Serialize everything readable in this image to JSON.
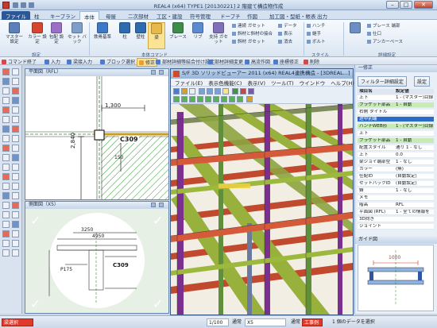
{
  "titlebar": {
    "title": "REAL4 (x64) TYPE1 [20130221] 2 階建て構造物作成"
  },
  "tabs": [
    "ファイル",
    "柱",
    "キープラン",
    "本体",
    "母屋",
    "二次部材",
    "工区・建設",
    "符号管理",
    "ドープチ",
    "作図",
    "加工図・型紙・帳表",
    "出力"
  ],
  "ribbon": {
    "big_buttons": [
      {
        "label": "マスター\n設定",
        "color": "#5b7fb8"
      },
      {
        "label": "カラー\n設定",
        "color": "#d6462e"
      },
      {
        "label": "包配\n設定",
        "color": "#9a70c6"
      },
      {
        "label": "セット\nバック",
        "color": "#7f9ec9"
      },
      {
        "label": "鉄骨基準",
        "color": "#3c78c8"
      },
      {
        "label": "柱",
        "color": "#2d6ab0"
      },
      {
        "label": "壁柱",
        "color": "#2d6ab0"
      },
      {
        "label": "梁",
        "color": "#e8b84a"
      },
      {
        "label": "ブレース",
        "color": "#3e8c4a"
      },
      {
        "label": "リブ",
        "color": "#5a8bd0"
      },
      {
        "label": "支持\nガセット",
        "color": "#8070b9"
      }
    ],
    "small_buttons": [
      "連続 ガセット",
      "斜材と斜材の接合",
      "斜材 ガセット",
      "データ",
      "表示",
      "消去",
      "ハンチ",
      "継手",
      "ボルト",
      "ブレース 端部",
      "仕口",
      "アンカーベース"
    ],
    "groups": [
      "設定",
      "本体コマンド",
      "スタイル",
      "詳細設定"
    ]
  },
  "command_bar": {
    "items": [
      "コマンド終了",
      "入力",
      "梁接入力",
      "ブロック選択",
      "修正",
      "部材詳細等結合付け設定",
      "部材詳細変更",
      "高流作図",
      "座標修正",
      "削除"
    ],
    "active_index": 4
  },
  "plan_view": {
    "title": "平面図（RFL）",
    "dim_top": "1,300",
    "dim_left": "2,840",
    "dim_mid": "150",
    "label": "C309"
  },
  "elev_view": {
    "title": "側面図（X5）",
    "labels": [
      "3250",
      "4950",
      "P175",
      "C309"
    ]
  },
  "viewer": {
    "title": "S/F 3D ソリッドビューアー 2011 (x64) REAL4連携構造 - [3DREAL...]",
    "menu": [
      "ファイル(E)",
      "表示色機能(C)",
      "表示(V)",
      "ツール(T)",
      "ウインドウ",
      "ヘルプ(H)"
    ]
  },
  "right_panel": {
    "title": "一修正",
    "buttons": [
      "フィルター詳細設定",
      "設定"
    ],
    "header": [
      "項目名",
      "設定値"
    ],
    "rows": [
      {
        "name": "上下",
        "value": "1 - (マスター)目録",
        "style": ""
      },
      {
        "name": "ブラケット部品",
        "value": "1 - 自動",
        "style": "g"
      },
      {
        "name": "右側 タイトル",
        "value": "",
        "style": ""
      },
      {
        "name": "途中別端",
        "value": "",
        "style": "b"
      },
      {
        "name": "ハンチWEB形",
        "value": "1 - (マスター)目録",
        "style": "g"
      },
      {
        "name": "上下",
        "value": "",
        "style": ""
      },
      {
        "name": "ブラケット部品",
        "value": "1 - 自動",
        "style": "g"
      },
      {
        "name": "配置スタイル",
        "value": "通り 1 - なし",
        "style": ""
      },
      {
        "name": "上下",
        "value": "0.0",
        "style": ""
      },
      {
        "name": "梁ジョイ端部型",
        "value": "1 - なし",
        "style": ""
      },
      {
        "name": "カラー",
        "value": "(無)",
        "style": ""
      },
      {
        "name": "仕配ID",
        "value": "(自動設定)",
        "style": ""
      },
      {
        "name": "セットバックID",
        "value": "(自動設定)",
        "style": ""
      },
      {
        "name": "鋳",
        "value": "1 - なし",
        "style": ""
      },
      {
        "name": "メモ",
        "value": "",
        "style": ""
      },
      {
        "name": "階高",
        "value": "RFL",
        "style": ""
      },
      {
        "name": "平面図 (RFL)",
        "value": "1 - 全ての情報を",
        "style": ""
      },
      {
        "name": "3D向き",
        "value": "",
        "style": ""
      },
      {
        "name": "ジョイント",
        "value": "",
        "style": ""
      }
    ],
    "guide_title": "ガイド図",
    "guide_dim": "1000"
  },
  "status_bar": {
    "mode": "梁選択",
    "scale": "1/100",
    "mode2": "通常",
    "grid": "X5",
    "label3": "通常",
    "work": "工事例",
    "message": "1 個のデータを選択"
  }
}
